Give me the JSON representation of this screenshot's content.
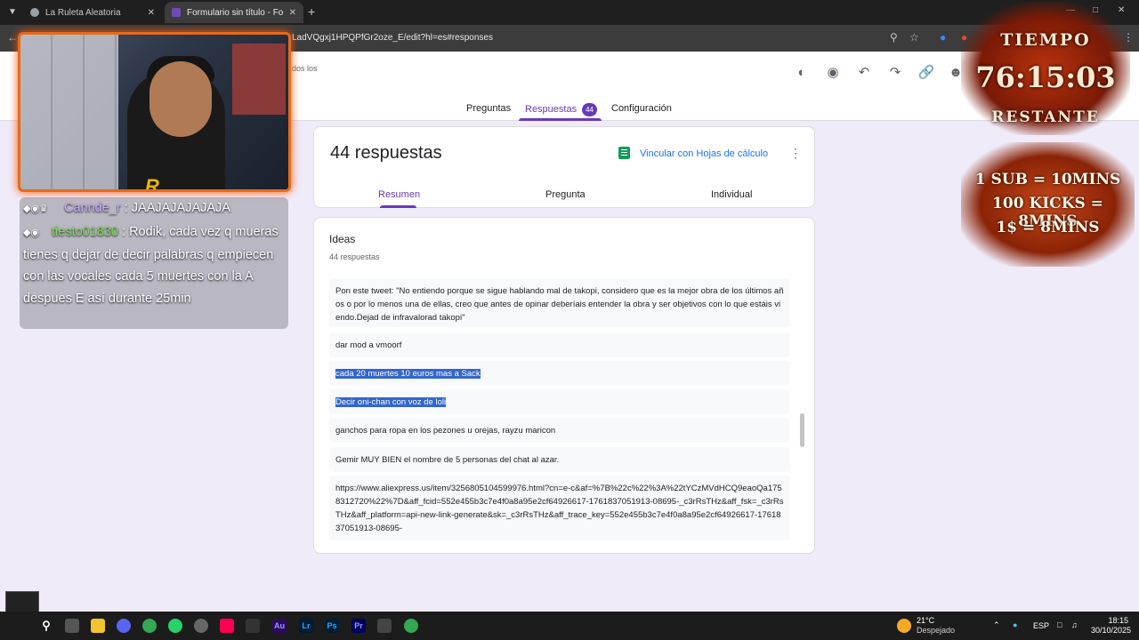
{
  "browser": {
    "tabs": [
      {
        "title": "La Ruleta Aleatoria",
        "favicon_color": "#9aa0a6"
      },
      {
        "title": "Formulario sin título - Formular",
        "favicon_color": "#7248b9"
      }
    ],
    "new_tab": "+",
    "url": "LadVQgxj1HPQPfGr2oze_E/edit?hl=es#responses"
  },
  "forms_header": {
    "saved_text": "dos los",
    "tabs": [
      {
        "label": "Preguntas"
      },
      {
        "label": "Respuestas",
        "badge": "44"
      },
      {
        "label": "Configuración"
      }
    ]
  },
  "summary_card": {
    "title": "44 respuestas",
    "sheets_link": "Vincular con Hojas de cálculo",
    "subtabs": [
      "Resumen",
      "Pregunta",
      "Individual"
    ]
  },
  "question_card": {
    "title": "Ideas",
    "subtitle": "44 respuestas",
    "answers": [
      "Pon este tweet: \"No entiendo porque se sigue hablando mal de takopi, considero que es la mejor obra de los últimos años o por lo menos una de ellas, creo que antes de opinar deberíais entender la obra y ser objetivos con lo que estáis viendo.Dejad de infravalorad takopi\"",
      "dar mod a vmoorf",
      "cada 20 muertes 10 euros mas a Sack",
      "Decir oni-chan con voz de loli",
      "ganchos para ropa en los pezones u orejas, rayzu maricon",
      "Gemir MUY BIEN el nombre de 5 personas del chat al azar.",
      "https://www.aliexpress.us/item/3256805104599976.html?cn=e-c&af=%7B%22c%22%3A%22tYCzMVdHCQ9eaoQa1758312720%22%7D&aff_fcid=552e455b3c7e4f0a8a95e2cf64926617-1761837051913-08695-_c3rRsTHz&aff_fsk=_c3rRsTHz&aff_platform=api-new-link-generate&sk=_c3rRsTHz&aff_trace_key=552e455b3c7e4f0a8a95e2cf64926617-1761837051913-08695-"
    ],
    "highlighted": [
      2,
      3
    ]
  },
  "stream": {
    "chat": [
      {
        "user": "Cannde_r",
        "sep": " : ",
        "message": "JAAJAJAJAJAJA"
      },
      {
        "user": "tiesto01830",
        "sep": " : ",
        "message": "Rodik, cada vez q mueras tienes q dejar de decir palabras q empiecen con las vocales cada 5 muertes con la A despues E así durante 25min"
      }
    ],
    "timer": {
      "label_top": "TIEMPO",
      "time": "76:15:03",
      "label_bottom": "RESTANTE"
    },
    "rates": [
      "1 SUB = 10MINS",
      "100 KICKS = 8MINS",
      "1$ = 8MINS"
    ]
  },
  "taskbar": {
    "weather_temp": "21°C",
    "weather_desc": "Despejado",
    "lang": "ESP",
    "time": "18:15",
    "date": "30/10/2025"
  }
}
